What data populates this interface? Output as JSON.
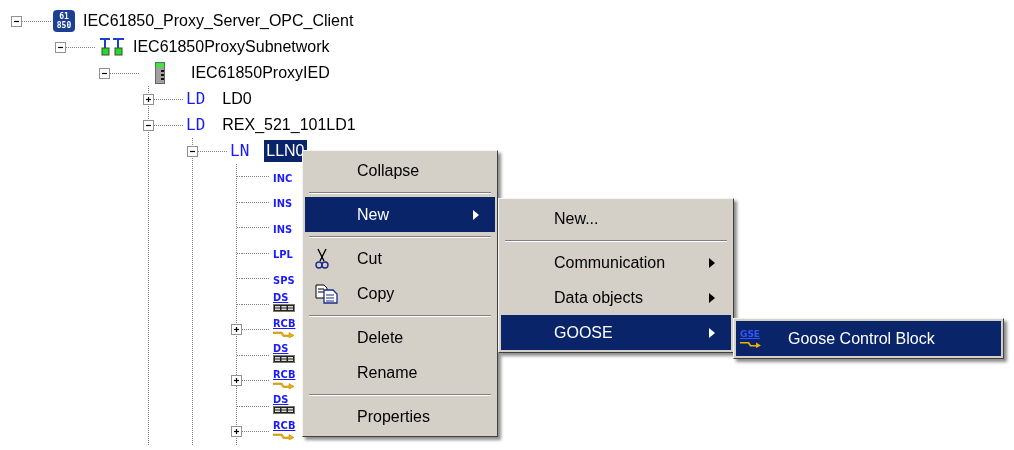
{
  "tree": [
    {
      "kind": "server",
      "badge": [
        "61",
        "850"
      ],
      "label": "IEC61850_Proxy_Server_OPC_Client",
      "expanded": true,
      "selected": false,
      "children": [
        {
          "kind": "subnetwork",
          "label": "IEC61850ProxySubnetwork",
          "expanded": true,
          "selected": false,
          "children": [
            {
              "kind": "ied",
              "label": "IEC61850ProxyIED",
              "expanded": true,
              "selected": false,
              "children": [
                {
                  "tag": "LD",
                  "label": "LD0",
                  "expanded": false,
                  "selected": false
                },
                {
                  "tag": "LD",
                  "label": "REX_521_101LD1",
                  "expanded": true,
                  "selected": false,
                  "children": [
                    {
                      "tag": "LN",
                      "label": "LLN0",
                      "expanded": true,
                      "selected": true,
                      "children": [
                        {
                          "kind": "data_object",
                          "tag": "INC"
                        },
                        {
                          "kind": "data_object",
                          "tag": "INS"
                        },
                        {
                          "kind": "data_object",
                          "tag": "INS"
                        },
                        {
                          "kind": "data_object",
                          "tag": "LPL"
                        },
                        {
                          "kind": "data_object",
                          "tag": "SPS"
                        },
                        {
                          "kind": "dataset",
                          "tag": "DS"
                        },
                        {
                          "kind": "report_control",
                          "tag": "RCB",
                          "expanded": false
                        },
                        {
                          "kind": "dataset",
                          "tag": "DS"
                        },
                        {
                          "kind": "report_control",
                          "tag": "RCB",
                          "expanded": false
                        },
                        {
                          "kind": "dataset",
                          "tag": "DS"
                        },
                        {
                          "kind": "report_control",
                          "tag": "RCB",
                          "expanded": false
                        }
                      ]
                    }
                  ]
                }
              ]
            }
          ]
        }
      ]
    }
  ],
  "menus": [
    {
      "items": [
        {
          "kind": "command",
          "label": "Collapse",
          "selected": false,
          "submenu": false
        },
        {
          "kind": "separator"
        },
        {
          "kind": "command",
          "label": "New",
          "selected": true,
          "submenu": true
        },
        {
          "kind": "separator"
        },
        {
          "kind": "cut",
          "label": "Cut",
          "selected": false,
          "submenu": false
        },
        {
          "kind": "copy",
          "label": "Copy",
          "selected": false,
          "submenu": false
        },
        {
          "kind": "separator"
        },
        {
          "kind": "command",
          "label": "Delete",
          "selected": false,
          "submenu": false
        },
        {
          "kind": "command",
          "label": "Rename",
          "selected": false,
          "submenu": false
        },
        {
          "kind": "separator"
        },
        {
          "kind": "command",
          "label": "Properties",
          "selected": false,
          "submenu": false
        }
      ]
    },
    {
      "items": [
        {
          "kind": "command",
          "label": "New...",
          "selected": false,
          "submenu": false
        },
        {
          "kind": "separator"
        },
        {
          "kind": "command",
          "label": "Communication",
          "selected": false,
          "submenu": true
        },
        {
          "kind": "command",
          "label": "Data objects",
          "selected": false,
          "submenu": true
        },
        {
          "kind": "command",
          "label": "GOOSE",
          "selected": true,
          "submenu": true
        }
      ]
    },
    {
      "items": [
        {
          "kind": "goose_control",
          "icon_text": "GSE",
          "label": "Goose Control Block",
          "selected": true,
          "submenu": false
        }
      ]
    }
  ]
}
